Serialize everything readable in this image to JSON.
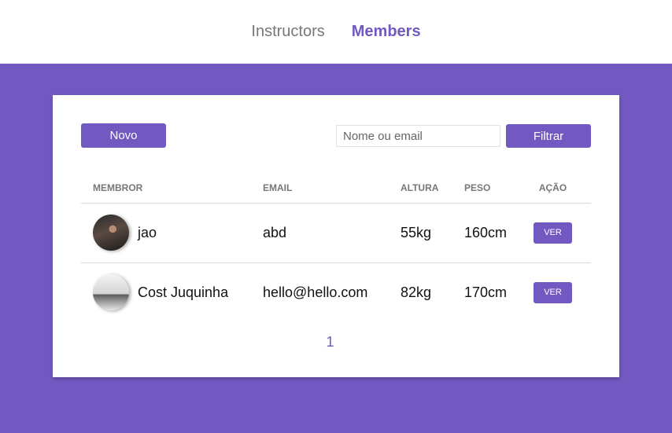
{
  "nav": {
    "links": [
      {
        "label": "Instructors",
        "active": false
      },
      {
        "label": "Members",
        "active": true
      }
    ]
  },
  "toolbar": {
    "new_label": "Novo",
    "search_placeholder": "Nome ou email",
    "search_value": "",
    "filter_label": "Filtrar"
  },
  "table": {
    "headers": {
      "member": "Membror",
      "email": "Email",
      "height": "Altura",
      "weight": "Peso",
      "action": "Ação"
    },
    "rows": [
      {
        "name": "jao",
        "email": "abd",
        "height": "55kg",
        "weight": "160cm",
        "action": "Ver"
      },
      {
        "name": "Cost Juquinha",
        "email": "hello@hello.com",
        "height": "82kg",
        "weight": "170cm",
        "action": "Ver"
      }
    ]
  },
  "pagination": {
    "current": "1"
  },
  "colors": {
    "accent": "#7159c1",
    "background": "#7159c1",
    "card": "#ffffff"
  }
}
